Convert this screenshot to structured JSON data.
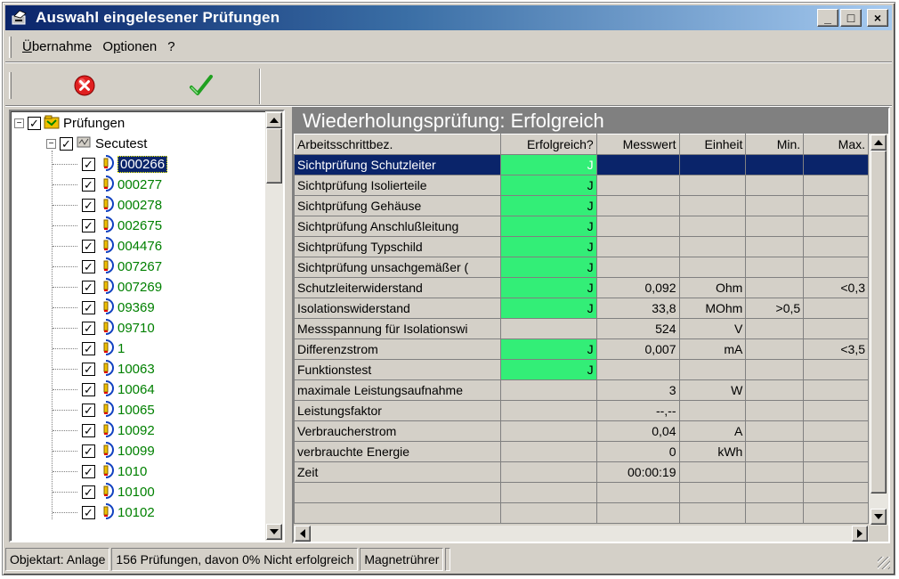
{
  "window": {
    "title": "Auswahl eingelesener Prüfungen",
    "minimize_label": "_",
    "maximize_label": "□",
    "close_label": "×"
  },
  "menu": [
    {
      "label": "Übernahme",
      "mnemonic": "Ü",
      "rest": "bernahme"
    },
    {
      "label": "Optionen",
      "mnemonic_pre": "O",
      "mnemonic": "p",
      "rest": "tionen"
    },
    {
      "label": "?"
    }
  ],
  "toolbar": {
    "cancel_icon": "cancel-icon",
    "accept_icon": "checkmark-icon",
    "colors": {
      "cancel": "#e02020",
      "accept": "#20a020"
    }
  },
  "tree": {
    "root": {
      "label": "Prüfungen",
      "expander": "−"
    },
    "group": {
      "label": "Secutest",
      "expander": "−"
    },
    "items": [
      {
        "label": "000266",
        "selected": true
      },
      {
        "label": "000277"
      },
      {
        "label": "000278"
      },
      {
        "label": "002675"
      },
      {
        "label": "004476"
      },
      {
        "label": "007267"
      },
      {
        "label": "007269"
      },
      {
        "label": "09369"
      },
      {
        "label": "09710"
      },
      {
        "label": "1"
      },
      {
        "label": "10063"
      },
      {
        "label": "10064"
      },
      {
        "label": "10065"
      },
      {
        "label": "10092"
      },
      {
        "label": "10099"
      },
      {
        "label": "1010"
      },
      {
        "label": "10100"
      },
      {
        "label": "10102"
      }
    ]
  },
  "result": {
    "header": "Wiederholungsprüfung: Erfolgreich",
    "columns": [
      "Arbeitsschrittbez.",
      "Erfolgreich?",
      "Messwert",
      "Einheit",
      "Min.",
      "Max."
    ],
    "rows": [
      {
        "name": "Sichtprüfung Schutzleiter",
        "ok": "J",
        "value": "",
        "unit": "",
        "min": "",
        "max": "",
        "selected": true
      },
      {
        "name": "Sichtprüfung Isolierteile",
        "ok": "J",
        "value": "",
        "unit": "",
        "min": "",
        "max": ""
      },
      {
        "name": "Sichtprüfung Gehäuse",
        "ok": "J",
        "value": "",
        "unit": "",
        "min": "",
        "max": ""
      },
      {
        "name": "Sichtprüfung Anschlußleitung",
        "ok": "J",
        "value": "",
        "unit": "",
        "min": "",
        "max": ""
      },
      {
        "name": "Sichtprüfung Typschild",
        "ok": "J",
        "value": "",
        "unit": "",
        "min": "",
        "max": ""
      },
      {
        "name": "Sichtprüfung unsachgemäßer (",
        "ok": "J",
        "value": "",
        "unit": "",
        "min": "",
        "max": ""
      },
      {
        "name": "Schutzleiterwiderstand",
        "ok": "J",
        "value": "0,092",
        "unit": "Ohm",
        "min": "",
        "max": "<0,3"
      },
      {
        "name": "Isolationswiderstand",
        "ok": "J",
        "value": "33,8",
        "unit": "MOhm",
        "min": ">0,5",
        "max": ""
      },
      {
        "name": "Messspannung für Isolationswi",
        "ok": "",
        "value": "524",
        "unit": "V",
        "min": "",
        "max": ""
      },
      {
        "name": "Differenzstrom",
        "ok": "J",
        "value": "0,007",
        "unit": "mA",
        "min": "",
        "max": "<3,5"
      },
      {
        "name": "Funktionstest",
        "ok": "J",
        "value": "",
        "unit": "",
        "min": "",
        "max": ""
      },
      {
        "name": "maximale Leistungsaufnahme",
        "ok": "",
        "value": "3",
        "unit": "W",
        "min": "",
        "max": ""
      },
      {
        "name": "Leistungsfaktor",
        "ok": "",
        "value": "--,--",
        "unit": "",
        "min": "",
        "max": ""
      },
      {
        "name": "Verbraucherstrom",
        "ok": "",
        "value": "0,04",
        "unit": "A",
        "min": "",
        "max": ""
      },
      {
        "name": "verbrauchte Energie",
        "ok": "",
        "value": "0",
        "unit": "kWh",
        "min": "",
        "max": ""
      },
      {
        "name": "Zeit",
        "ok": "",
        "value": "00:00:19",
        "unit": "",
        "min": "",
        "max": ""
      },
      {
        "name": "",
        "ok": "",
        "value": "",
        "unit": "",
        "min": "",
        "max": ""
      },
      {
        "name": "",
        "ok": "",
        "value": "",
        "unit": "",
        "min": "",
        "max": ""
      }
    ],
    "ok_color": "#33ee77"
  },
  "status": {
    "object_type": "Objektart: Anlage",
    "summary": "156 Prüfungen, davon 0% Nicht erfolgreich",
    "device": "Magnetrührer",
    "extra": ""
  }
}
